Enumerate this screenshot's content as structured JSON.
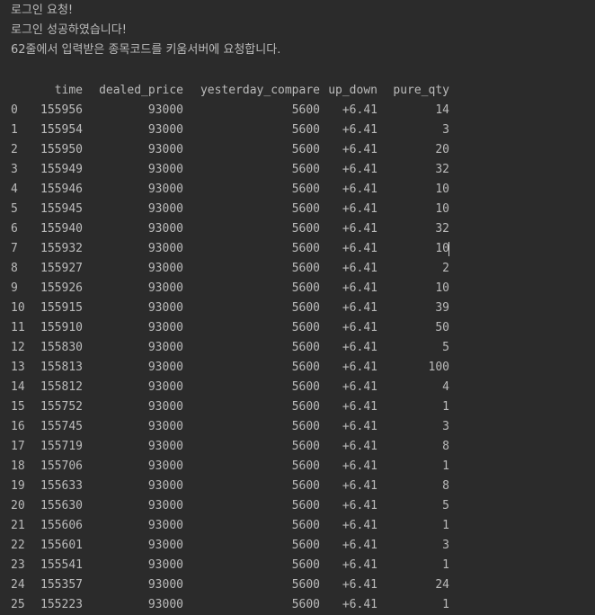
{
  "console": {
    "messages": [
      "로그인 요청!",
      "로그인 성공하였습니다!",
      "62줄에서 입력받은 종목코드를 키움서버에 요청합니다."
    ]
  },
  "table": {
    "columns": [
      "time",
      "dealed_price",
      "yesterday_compare",
      "up_down",
      "pure_qty"
    ],
    "rows": [
      [
        "0",
        "155956",
        "93000",
        "5600",
        "+6.41",
        "14"
      ],
      [
        "1",
        "155954",
        "93000",
        "5600",
        "+6.41",
        "3"
      ],
      [
        "2",
        "155950",
        "93000",
        "5600",
        "+6.41",
        "20"
      ],
      [
        "3",
        "155949",
        "93000",
        "5600",
        "+6.41",
        "32"
      ],
      [
        "4",
        "155946",
        "93000",
        "5600",
        "+6.41",
        "10"
      ],
      [
        "5",
        "155945",
        "93000",
        "5600",
        "+6.41",
        "10"
      ],
      [
        "6",
        "155940",
        "93000",
        "5600",
        "+6.41",
        "32"
      ],
      [
        "7",
        "155932",
        "93000",
        "5600",
        "+6.41",
        "10"
      ],
      [
        "8",
        "155927",
        "93000",
        "5600",
        "+6.41",
        "2"
      ],
      [
        "9",
        "155926",
        "93000",
        "5600",
        "+6.41",
        "10"
      ],
      [
        "10",
        "155915",
        "93000",
        "5600",
        "+6.41",
        "39"
      ],
      [
        "11",
        "155910",
        "93000",
        "5600",
        "+6.41",
        "50"
      ],
      [
        "12",
        "155830",
        "93000",
        "5600",
        "+6.41",
        "5"
      ],
      [
        "13",
        "155813",
        "93000",
        "5600",
        "+6.41",
        "100"
      ],
      [
        "14",
        "155812",
        "93000",
        "5600",
        "+6.41",
        "4"
      ],
      [
        "15",
        "155752",
        "93000",
        "5600",
        "+6.41",
        "1"
      ],
      [
        "16",
        "155745",
        "93000",
        "5600",
        "+6.41",
        "3"
      ],
      [
        "17",
        "155719",
        "93000",
        "5600",
        "+6.41",
        "8"
      ],
      [
        "18",
        "155706",
        "93000",
        "5600",
        "+6.41",
        "1"
      ],
      [
        "19",
        "155633",
        "93000",
        "5600",
        "+6.41",
        "8"
      ],
      [
        "20",
        "155630",
        "93000",
        "5600",
        "+6.41",
        "5"
      ],
      [
        "21",
        "155606",
        "93000",
        "5600",
        "+6.41",
        "1"
      ],
      [
        "22",
        "155601",
        "93000",
        "5600",
        "+6.41",
        "3"
      ],
      [
        "23",
        "155541",
        "93000",
        "5600",
        "+6.41",
        "1"
      ],
      [
        "24",
        "155357",
        "93000",
        "5600",
        "+6.41",
        "24"
      ],
      [
        "25",
        "155223",
        "93000",
        "5600",
        "+6.41",
        "1"
      ]
    ]
  }
}
